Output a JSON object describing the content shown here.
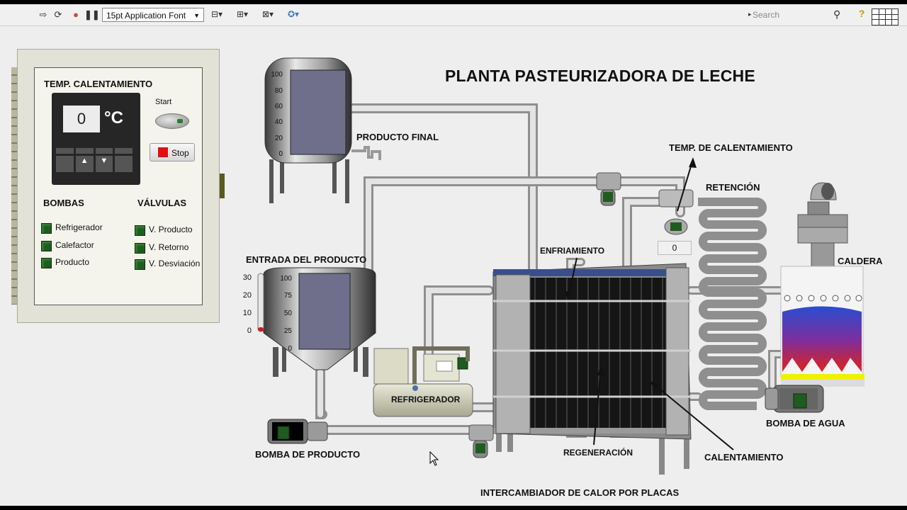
{
  "toolbar": {
    "font_select": "15pt Application Font",
    "search_placeholder": "Search",
    "help": "?"
  },
  "panel": {
    "temp_title": "TEMP. CALENTAMIENTO",
    "temp_value": "0",
    "temp_unit": "°C",
    "key_up": "▲",
    "key_down": "▼",
    "start_label": "Start",
    "stop_label": "Stop",
    "bombas_title": "BOMBAS",
    "valvulas_title": "VÁLVULAS",
    "bombas": [
      "Refrigerador",
      "Calefactor",
      "Producto"
    ],
    "valvulas": [
      "V. Producto",
      "V. Retorno",
      "V. Desviación"
    ]
  },
  "diagram": {
    "title": "PLANTA PASTEURIZADORA DE LECHE",
    "producto_final": "PRODUCTO FINAL",
    "entrada_producto": "ENTRADA DEL PRODUCTO",
    "temp_calentamiento": "TEMP. DE CALENTAMIENTO",
    "temp_readout": "0",
    "retencion": "RETENCIÓN",
    "caldera": "CALDERA",
    "enfriamiento": "ENFRIAMIENTO",
    "refrigerador": "REFRIGERADOR",
    "bomba_producto": "BOMBA DE PRODUCTO",
    "regeneracion": "REGENERACIÓN",
    "calentamiento": "CALENTAMIENTO",
    "bomba_agua": "BOMBA DE AGUA",
    "intercambiador": "INTERCAMBIADOR DE CALOR POR PLACAS",
    "tank_top_scale": [
      "100",
      "80",
      "60",
      "40",
      "20",
      "0"
    ],
    "tank_bottom_scale": [
      "100",
      "75",
      "50",
      "25",
      "0"
    ],
    "thermo_scale": [
      "30",
      "20",
      "10",
      "0"
    ]
  },
  "levels": {
    "tank_top_fraction": 0,
    "tank_bottom_fraction": 0,
    "thermometer_value": 0
  },
  "colors": {
    "tank_fill": "#6f6f8c",
    "led_on": "#1f5c1f",
    "stop_red": "#e01010",
    "pipe": "#d4d4d4",
    "exchanger_plate": "#151515"
  }
}
